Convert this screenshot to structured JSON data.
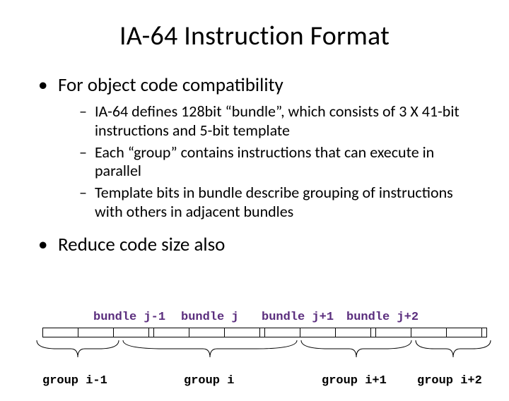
{
  "title": "IA-64 Instruction Format",
  "bullets": {
    "b1": "For object code compatibility",
    "b1_sub": [
      "IA-64 defines 128bit “bundle”, which consists of 3 X 41-bit instructions and 5-bit template",
      "Each “group” contains instructions that can execute in parallel",
      "Template bits in bundle describe grouping of instructions with others in adjacent bundles"
    ],
    "b2": "Reduce code size also"
  },
  "diagram": {
    "bundles": [
      "bundle j-1",
      "bundle j",
      "bundle j+1",
      "bundle j+2"
    ],
    "groups": [
      "group i-1",
      "group i",
      "group i+1",
      "group i+2"
    ]
  }
}
